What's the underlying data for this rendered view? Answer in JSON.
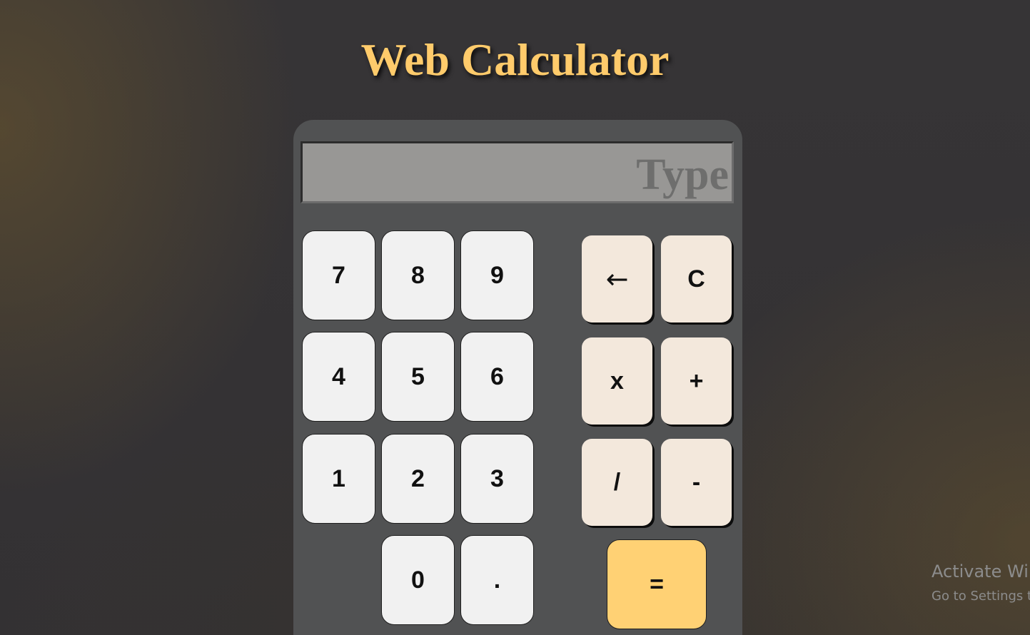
{
  "title": "Web Calculator",
  "display": {
    "placeholder": "Type",
    "value": ""
  },
  "keys": {
    "seven": "7",
    "eight": "8",
    "nine": "9",
    "four": "4",
    "five": "5",
    "six": "6",
    "one": "1",
    "two": "2",
    "three": "3",
    "zero": "0",
    "decimal": ".",
    "backspace": "←",
    "clear": "C",
    "multiply": "x",
    "add": "+",
    "divide": "/",
    "subtract": "-",
    "equals": "="
  },
  "watermark": {
    "line1": "Activate Windows",
    "line2": "Go to Settings to activate Windows."
  },
  "colors": {
    "title": "#ffcb6b",
    "equals_key": "#ffd174",
    "operator_key": "#f3e8dc",
    "number_key": "#f1f1f1",
    "calculator_body": "#515253",
    "display_bg": "#989795"
  }
}
